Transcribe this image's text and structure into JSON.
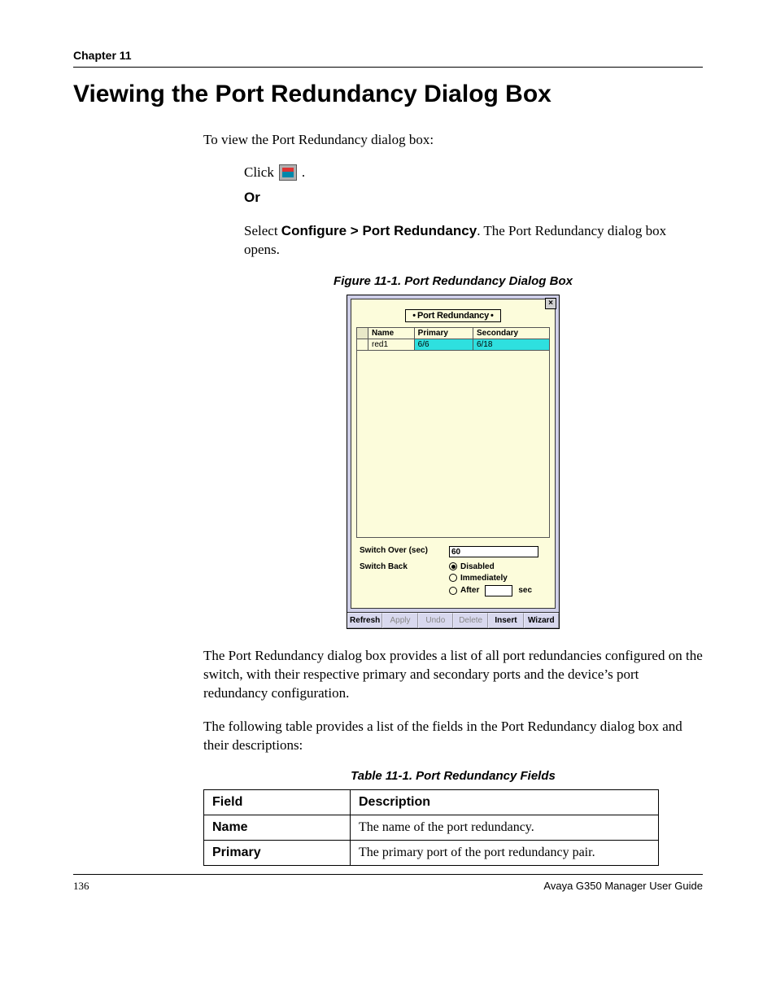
{
  "header": {
    "chapter": "Chapter 11"
  },
  "title": "Viewing the Port Redundancy Dialog Box",
  "intro": "To view the Port Redundancy dialog box:",
  "click_label": "Click",
  "click_period": ".",
  "or_label": "Or",
  "select_prefix": "Select ",
  "select_menu": "Configure > Port Redundancy",
  "select_suffix": ". The Port Redundancy dialog box opens.",
  "figure_caption": "Figure 11-1.  Port Redundancy Dialog Box",
  "dialog": {
    "title": "Port Redundancy",
    "close": "×",
    "columns": {
      "name": "Name",
      "primary": "Primary",
      "secondary": "Secondary"
    },
    "row": {
      "name": "red1",
      "primary": "6/6",
      "secondary": "6/18"
    },
    "switch_over_label": "Switch Over (sec)",
    "switch_over_value": "60",
    "switch_back_label": "Switch Back",
    "rb_disabled": "Disabled",
    "rb_immediately": "Immediately",
    "rb_after": "After",
    "sec_suffix": "sec",
    "buttons": {
      "refresh": "Refresh",
      "apply": "Apply",
      "undo": "Undo",
      "delete": "Delete",
      "insert": "Insert",
      "wizard": "Wizard"
    }
  },
  "para_after_figure": "The Port Redundancy dialog box provides a list of all port redundancies configured on the switch, with their respective primary and secondary ports and the device’s port redundancy configuration.",
  "para_table_intro": "The following table provides a list of the fields in the Port Redundancy dialog box and their descriptions:",
  "table_caption": "Table 11-1.  Port Redundancy Fields",
  "fields_table": {
    "h_field": "Field",
    "h_desc": "Description",
    "rows": [
      {
        "field": "Name",
        "desc": "The name of the port redundancy."
      },
      {
        "field": "Primary",
        "desc": "The primary port of the port redundancy pair."
      }
    ]
  },
  "footer": {
    "page": "136",
    "guide": "Avaya G350 Manager User Guide"
  }
}
